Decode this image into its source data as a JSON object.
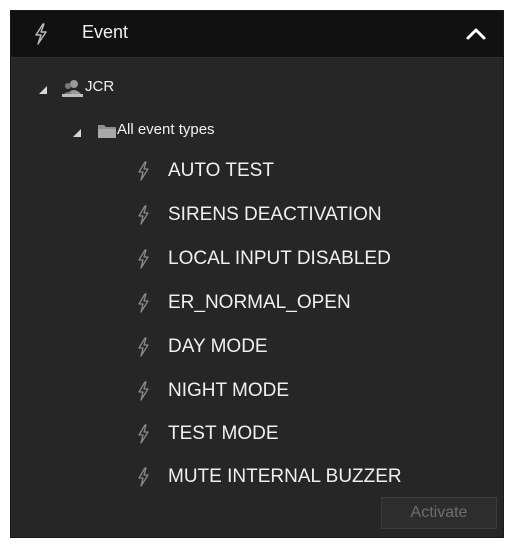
{
  "header": {
    "icon": "lightning-bolt-icon",
    "title": "Event",
    "collapse_icon": "chevron-up-icon"
  },
  "tree": {
    "root": {
      "label": "JCR",
      "icon": "user-group-icon",
      "expanded": true
    },
    "group": {
      "label": "All event types",
      "icon": "folder-icon",
      "expanded": true
    },
    "events": [
      {
        "label": "AUTO TEST",
        "icon": "lightning-bolt-icon"
      },
      {
        "label": "SIRENS DEACTIVATION",
        "icon": "lightning-bolt-icon"
      },
      {
        "label": "LOCAL INPUT DISABLED",
        "icon": "lightning-bolt-icon"
      },
      {
        "label": "ER_NORMAL_OPEN",
        "icon": "lightning-bolt-icon"
      },
      {
        "label": "DAY MODE",
        "icon": "lightning-bolt-icon"
      },
      {
        "label": "NIGHT MODE",
        "icon": "lightning-bolt-icon"
      },
      {
        "label": "TEST MODE",
        "icon": "lightning-bolt-icon"
      },
      {
        "label": "MUTE INTERNAL BUZZER",
        "icon": "lightning-bolt-icon"
      }
    ]
  },
  "footer": {
    "activate_label": "Activate",
    "activate_enabled": false
  },
  "colors": {
    "panel_bg": "#262626",
    "header_bg": "#111111",
    "text": "#f0f0f0",
    "icon_gray": "#8a8a8a",
    "disabled_text": "#6e6e6e"
  }
}
